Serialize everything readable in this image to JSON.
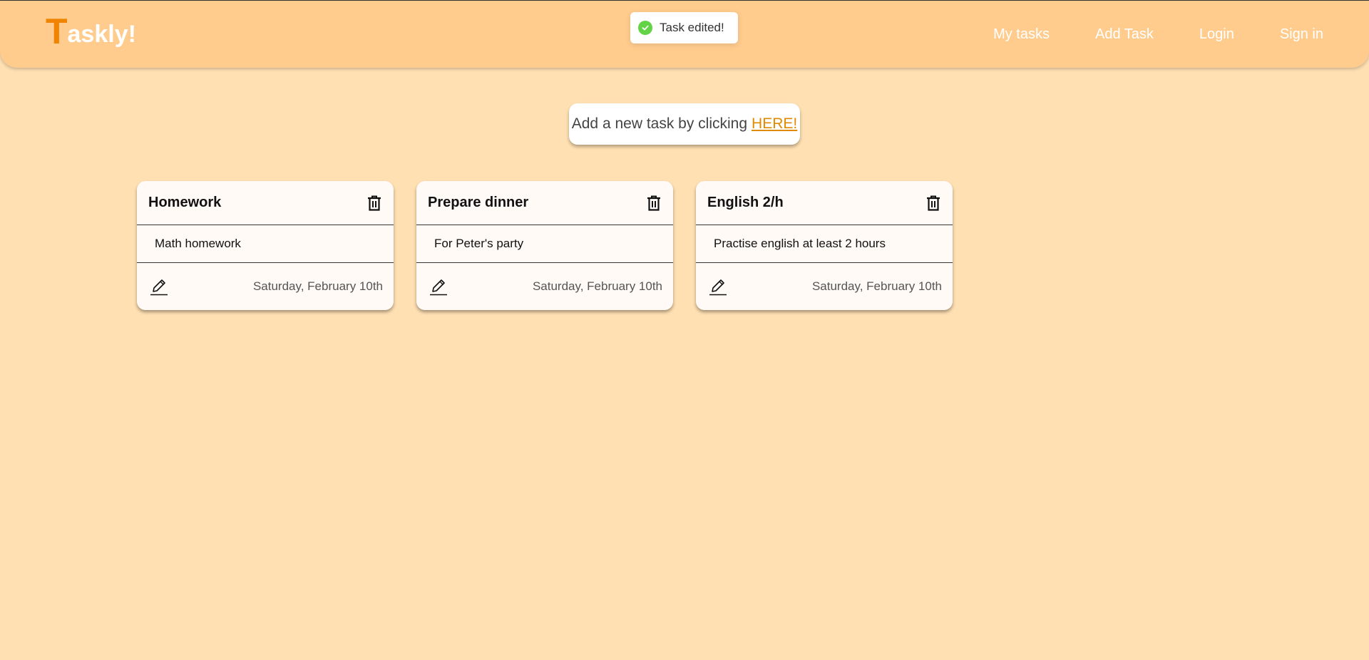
{
  "brand": {
    "first_letter": "T",
    "rest": "askly!",
    "accent_color": "#f08400"
  },
  "nav": [
    {
      "label": "My tasks"
    },
    {
      "label": "Add Task"
    },
    {
      "label": "Login"
    },
    {
      "label": "Sign in"
    }
  ],
  "toast": {
    "message": "Task edited!",
    "icon": "check-circle-icon",
    "status_color": "#61d345"
  },
  "add_prompt": {
    "text": "Add a new task by clicking",
    "link_label": "HERE!"
  },
  "tasks": [
    {
      "title": "Homework",
      "description": "Math homework",
      "date": "Saturday, February 10th"
    },
    {
      "title": "Prepare dinner",
      "description": "For Peter's party",
      "date": "Saturday, February 10th"
    },
    {
      "title": "English 2/h",
      "description": "Practise english at least 2 hours",
      "date": "Saturday, February 10th"
    }
  ],
  "icons": {
    "delete": "trash-icon",
    "edit": "pencil-icon"
  }
}
